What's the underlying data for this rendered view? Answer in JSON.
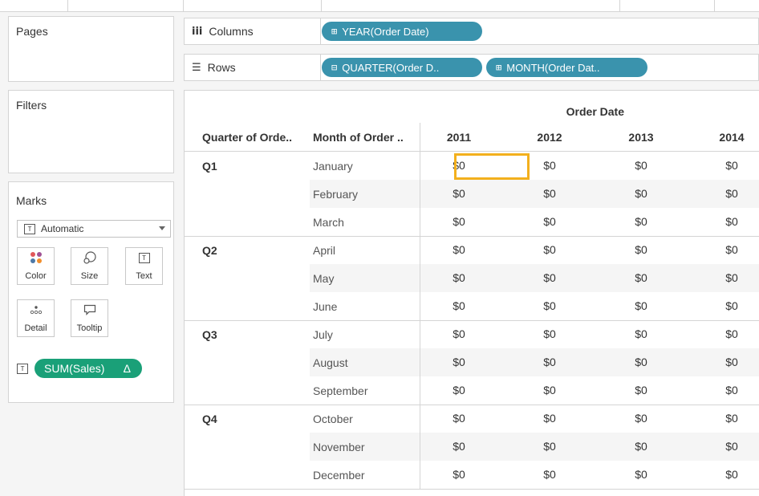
{
  "pages_card": {
    "title": "Pages"
  },
  "filters_card": {
    "title": "Filters"
  },
  "marks_card": {
    "title": "Marks",
    "mark_type": "Automatic",
    "buttons": {
      "color": "Color",
      "size": "Size",
      "text": "Text",
      "detail": "Detail",
      "tooltip": "Tooltip"
    },
    "field_pill": {
      "label": "SUM(Sales)",
      "delta_icon": "Δ"
    }
  },
  "shelves": {
    "columns": {
      "label": "Columns",
      "pills": [
        "YEAR(Order Date)"
      ]
    },
    "rows": {
      "label": "Rows",
      "pills": [
        "QUARTER(Order D..",
        "MONTH(Order Dat.."
      ]
    }
  },
  "view": {
    "column_header": "Order Date",
    "row_headers": [
      "Quarter of Orde..",
      "Month of Order .."
    ],
    "years": [
      "2011",
      "2012",
      "2013",
      "2014"
    ],
    "quarters": [
      {
        "label": "Q1",
        "months": [
          "January",
          "February",
          "March"
        ]
      },
      {
        "label": "Q2",
        "months": [
          "April",
          "May",
          "June"
        ]
      },
      {
        "label": "Q3",
        "months": [
          "July",
          "August",
          "September"
        ]
      },
      {
        "label": "Q4",
        "months": [
          "October",
          "November",
          "December"
        ]
      }
    ],
    "cell_value": "$0",
    "selected_cell": {
      "month": "January",
      "year": "2011"
    }
  },
  "colors": {
    "pill_dimension": "#3a93ad",
    "pill_measure": "#1aa078",
    "selection": "#f3b01d"
  }
}
